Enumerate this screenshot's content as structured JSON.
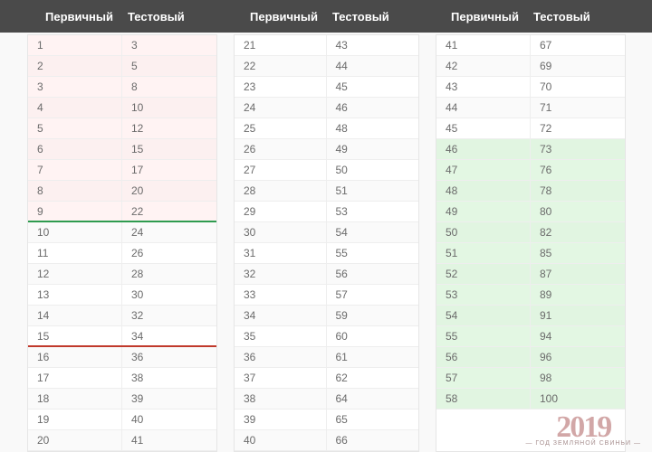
{
  "header": {
    "col_primary": "Первичный",
    "col_test": "Тестовый"
  },
  "watermark": {
    "year": "2019",
    "sub": "— ГОД ЗЕМЛЯНОЙ СВИНЬИ —"
  },
  "chart_data": {
    "type": "table",
    "title": "",
    "columns": [
      "Первичный",
      "Тестовый"
    ],
    "tables": [
      {
        "rows": [
          {
            "p": 1,
            "t": 3,
            "tint": "red"
          },
          {
            "p": 2,
            "t": 5,
            "tint": "red"
          },
          {
            "p": 3,
            "t": 8,
            "tint": "red"
          },
          {
            "p": 4,
            "t": 10,
            "tint": "red"
          },
          {
            "p": 5,
            "t": 12,
            "tint": "red"
          },
          {
            "p": 6,
            "t": 15,
            "tint": "red"
          },
          {
            "p": 7,
            "t": 17,
            "tint": "red"
          },
          {
            "p": 8,
            "t": 20,
            "tint": "red"
          },
          {
            "p": 9,
            "t": 22,
            "tint": "red",
            "sep": "green"
          },
          {
            "p": 10,
            "t": 24
          },
          {
            "p": 11,
            "t": 26
          },
          {
            "p": 12,
            "t": 28
          },
          {
            "p": 13,
            "t": 30
          },
          {
            "p": 14,
            "t": 32
          },
          {
            "p": 15,
            "t": 34,
            "sep": "red"
          },
          {
            "p": 16,
            "t": 36
          },
          {
            "p": 17,
            "t": 38
          },
          {
            "p": 18,
            "t": 39
          },
          {
            "p": 19,
            "t": 40
          },
          {
            "p": 20,
            "t": 41
          }
        ]
      },
      {
        "rows": [
          {
            "p": 21,
            "t": 43
          },
          {
            "p": 22,
            "t": 44
          },
          {
            "p": 23,
            "t": 45
          },
          {
            "p": 24,
            "t": 46
          },
          {
            "p": 25,
            "t": 48
          },
          {
            "p": 26,
            "t": 49
          },
          {
            "p": 27,
            "t": 50
          },
          {
            "p": 28,
            "t": 51
          },
          {
            "p": 29,
            "t": 53
          },
          {
            "p": 30,
            "t": 54
          },
          {
            "p": 31,
            "t": 55
          },
          {
            "p": 32,
            "t": 56
          },
          {
            "p": 33,
            "t": 57
          },
          {
            "p": 34,
            "t": 59
          },
          {
            "p": 35,
            "t": 60
          },
          {
            "p": 36,
            "t": 61
          },
          {
            "p": 37,
            "t": 62
          },
          {
            "p": 38,
            "t": 64
          },
          {
            "p": 39,
            "t": 65
          },
          {
            "p": 40,
            "t": 66
          }
        ]
      },
      {
        "rows": [
          {
            "p": 41,
            "t": 67
          },
          {
            "p": 42,
            "t": 69
          },
          {
            "p": 43,
            "t": 70
          },
          {
            "p": 44,
            "t": 71
          },
          {
            "p": 45,
            "t": 72
          },
          {
            "p": 46,
            "t": 73,
            "tint": "green"
          },
          {
            "p": 47,
            "t": 76,
            "tint": "green"
          },
          {
            "p": 48,
            "t": 78,
            "tint": "green"
          },
          {
            "p": 49,
            "t": 80,
            "tint": "green"
          },
          {
            "p": 50,
            "t": 82,
            "tint": "green"
          },
          {
            "p": 51,
            "t": 85,
            "tint": "green"
          },
          {
            "p": 52,
            "t": 87,
            "tint": "green"
          },
          {
            "p": 53,
            "t": 89,
            "tint": "green"
          },
          {
            "p": 54,
            "t": 91,
            "tint": "green"
          },
          {
            "p": 55,
            "t": 94,
            "tint": "green"
          },
          {
            "p": 56,
            "t": 96,
            "tint": "green"
          },
          {
            "p": 57,
            "t": 98,
            "tint": "green"
          },
          {
            "p": 58,
            "t": 100,
            "tint": "green"
          }
        ]
      }
    ]
  }
}
